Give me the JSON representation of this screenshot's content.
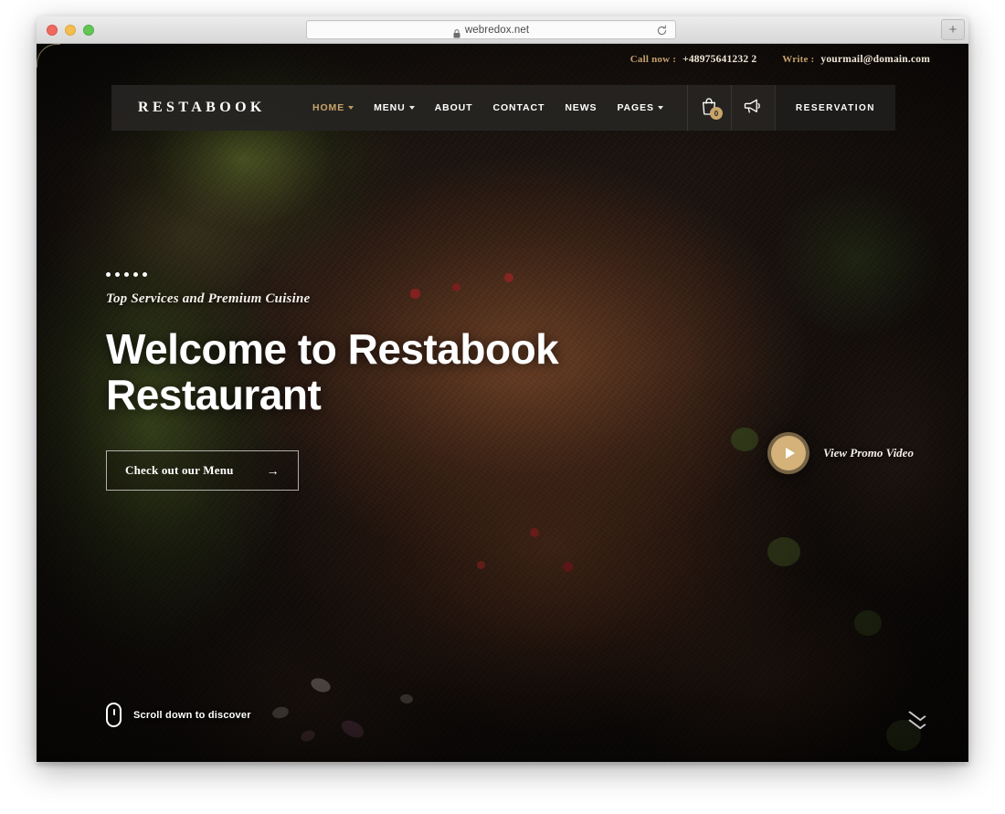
{
  "browser": {
    "url": "webredox.net",
    "lock_icon": "lock-icon",
    "reload_icon": "reload-icon",
    "new_tab_label": "+",
    "window_controls": [
      "close",
      "minimize",
      "maximize"
    ]
  },
  "topbar": {
    "call_label": "Call now :",
    "phone": "+48975641232 2",
    "write_label": "Write :",
    "email": "yourmail@domain.com"
  },
  "nav": {
    "logo": "RESTABOOK",
    "links": [
      {
        "label": "HOME",
        "has_dropdown": true,
        "active": true
      },
      {
        "label": "MENU",
        "has_dropdown": true,
        "active": false
      },
      {
        "label": "ABOUT",
        "has_dropdown": false,
        "active": false
      },
      {
        "label": "CONTACT",
        "has_dropdown": false,
        "active": false
      },
      {
        "label": "NEWS",
        "has_dropdown": false,
        "active": false
      },
      {
        "label": "PAGES",
        "has_dropdown": true,
        "active": false
      }
    ],
    "cart_icon": "shopping-bag-icon",
    "cart_count": "0",
    "announce_icon": "megaphone-icon",
    "reservation_label": "RESERVATION"
  },
  "hero": {
    "dots_count": 5,
    "subtitle": "Top Services and Premium Cuisine",
    "headline": "Welcome to Restabook Restaurant",
    "cta_label": "Check out our Menu",
    "cta_arrow": "→",
    "promo_label": "View Promo Video",
    "play_icon": "play-icon",
    "scroll_label": "Scroll down to discover",
    "scroll_icon": "mouse-scroll-icon",
    "chevron_icon": "chevron-double-down-icon"
  },
  "colors": {
    "accent_gold": "#c9a46b",
    "play_button": "#d4b279",
    "nav_background": "#262422",
    "text_light": "#ffffff"
  }
}
